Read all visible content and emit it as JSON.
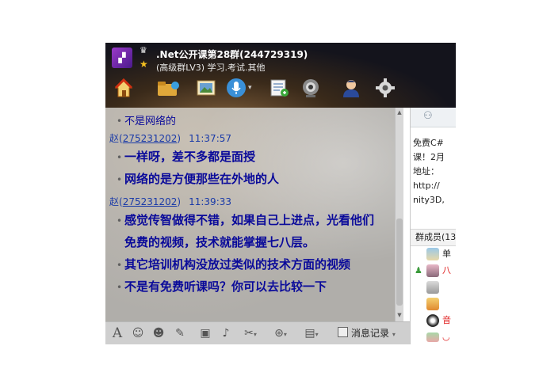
{
  "window": {
    "title": ".Net公开课第28群(244729319)",
    "subtitle": "(高级群LV3) 学习.考试.其他"
  },
  "toolbar": {
    "icons": [
      "home-icon",
      "folder-share-icon",
      "picture-icon",
      "mic-icon",
      "note-icon",
      "camera-icon",
      "member-icon",
      "gear-icon"
    ]
  },
  "chat": {
    "messages": [
      {
        "type": "text",
        "text": "不是网络的"
      },
      {
        "type": "sender",
        "name": "赵",
        "id": "275231202",
        "time": "11:37:57"
      },
      {
        "type": "text",
        "text": "一样呀，差不多都是面授"
      },
      {
        "type": "text",
        "text": "网络的是方便那些在外地的人"
      },
      {
        "type": "sender",
        "name": "赵",
        "id": "275231202",
        "time": "11:39:33"
      },
      {
        "type": "text",
        "text": "感觉传智做得不错，如果自己上进点，光看他们"
      },
      {
        "type": "text",
        "text": "免费的视频，技术就能掌握七八层。"
      },
      {
        "type": "text",
        "text": "其它培训机构没放过类似的技术方面的视频"
      },
      {
        "type": "text",
        "text": "不是有免费听课吗？你可以去比较一下"
      }
    ]
  },
  "bottom_toolbar": {
    "history_label": "消息记录"
  },
  "right_panel": {
    "notice_lines": [
      "免费C#",
      "课！2月",
      "地址：",
      "http://",
      "nity3D,"
    ],
    "members_header": "群成员(13",
    "members": [
      {
        "name": "单",
        "color": "#222222"
      },
      {
        "name": "八",
        "color": "#e02020"
      },
      {
        "name": "",
        "color": "#222222"
      },
      {
        "name": "",
        "color": "#222222"
      },
      {
        "name": "音",
        "color": "#e02020"
      },
      {
        "name": "◡",
        "color": "#e02020"
      }
    ]
  },
  "colors": {
    "message_text": "#0a0a9a",
    "sender_text": "#1a3aa8",
    "header_bg": "#14141c"
  }
}
